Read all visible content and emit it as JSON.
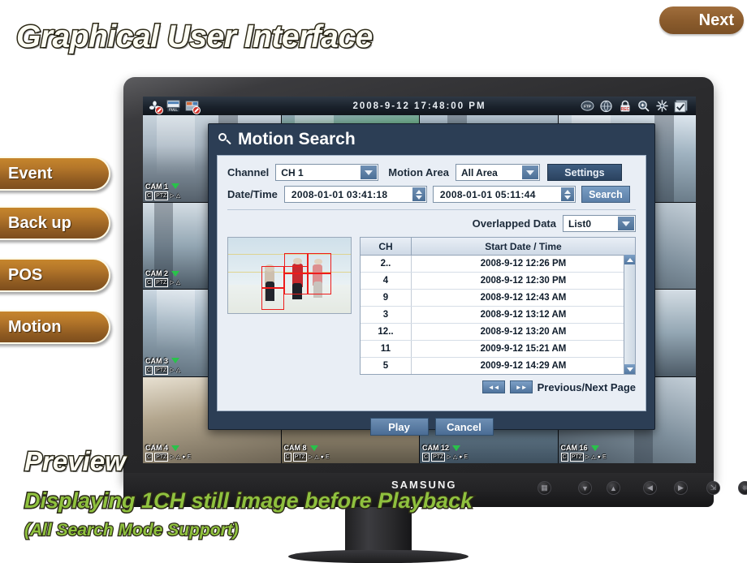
{
  "slide": {
    "title": "Graphical User Interface",
    "next_label": "Next",
    "preview_label": "Preview",
    "caption_line1": "Displaying 1CH still image before Playback",
    "caption_line2": "(All Search Mode Support)",
    "tabs": [
      {
        "label": "Event"
      },
      {
        "label": "Back up"
      },
      {
        "label": "POS"
      },
      {
        "label": "Motion"
      }
    ]
  },
  "monitor": {
    "brand": "SAMSUNG",
    "panel_buttons": [
      "menu-icon",
      "down-icon",
      "up-icon",
      "left-icon",
      "right-icon",
      "source-icon",
      "power-icon"
    ]
  },
  "dvr": {
    "clock": "2008-9-12 17:48:00 PM",
    "toolbar_left_icons": [
      "fan-disabled-icon",
      "full-screen-icon",
      "sequence-disabled-icon"
    ],
    "toolbar_right_icons": [
      "ftp-icon",
      "network-icon",
      "lock-rec-icon",
      "zoom-icon",
      "settings-icon",
      "checkbox-icon"
    ],
    "full_label": "FULL",
    "rec_label": "REC",
    "ftp_label": "FTP",
    "cameras": [
      {
        "label": "CAM 1"
      },
      {
        "label": ""
      },
      {
        "label": ""
      },
      {
        "label": ""
      },
      {
        "label": "CAM 2"
      },
      {
        "label": ""
      },
      {
        "label": ""
      },
      {
        "label": ""
      },
      {
        "label": "CAM 3"
      },
      {
        "label": ""
      },
      {
        "label": ""
      },
      {
        "label": ""
      },
      {
        "label": "CAM 4"
      },
      {
        "label": "CAM 8"
      },
      {
        "label": "CAM 12"
      },
      {
        "label": "CAM 16"
      }
    ],
    "cam_icon_labels": [
      "C",
      "PTZ",
      "play-icon",
      "alarm-icon",
      "person-icon",
      "E"
    ]
  },
  "dialog": {
    "title": "Motion Search",
    "title_icon": "search-icon",
    "channel_label": "Channel",
    "channel_value": "CH 1",
    "motion_area_label": "Motion Area",
    "motion_area_value": "All Area",
    "settings_label": "Settings",
    "datetime_label": "Date/Time",
    "datetime_start": "2008-01-01  03:41:18",
    "datetime_end": "2008-01-01  05:11:44",
    "search_label": "Search",
    "overlapped_label": "Overlapped Data",
    "overlapped_value": "List0",
    "table": {
      "columns": [
        "CH",
        "Start Date / Time"
      ],
      "rows": [
        {
          "ch": "2..",
          "datetime": "2008-9-12 12:26 PM"
        },
        {
          "ch": "4",
          "datetime": "2008-9-12 12:30 PM"
        },
        {
          "ch": "9",
          "datetime": "2008-9-12 12:43 AM"
        },
        {
          "ch": "3",
          "datetime": "2008-9-12 13:12 AM"
        },
        {
          "ch": "12..",
          "datetime": "2008-9-12 13:20 AM"
        },
        {
          "ch": "11",
          "datetime": "2009-9-12 15:21 AM"
        },
        {
          "ch": "5",
          "datetime": "2009-9-12 14:29 AM"
        }
      ]
    },
    "prev_button": "◄◄",
    "next_button": "►►",
    "paging_label": "Previous/Next Page",
    "play_label": "Play",
    "cancel_label": "Cancel"
  },
  "colors": {
    "accent_brown": "#8a5b2c",
    "tab_gradient_top": "#c6862c",
    "dialog_bg": "#2c3e55",
    "dialog_body": "#e9eef5",
    "caption_green": "#8fc13e",
    "motion_box_red": "#ee1c1c"
  }
}
